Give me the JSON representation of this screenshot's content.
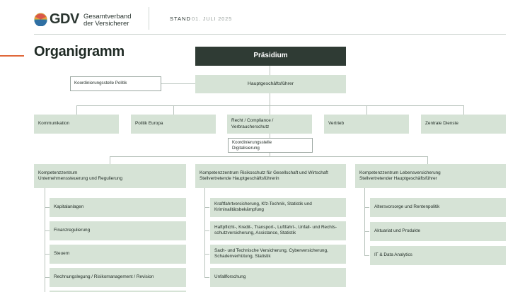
{
  "header": {
    "logo_mark": "GDV",
    "org_line1": "Gesamtverband",
    "org_line2": "der Versicherer",
    "stand_label": "STAND",
    "stand_date": "01. JULI 2025"
  },
  "page_title": "Organigramm",
  "top": {
    "praesidium": "Präsidium",
    "koordinierung_politik": "Koordinierungsstelle Politik",
    "hauptgeschaeftsfuehrer": "Hauptgeschäftsführer"
  },
  "departments": [
    "Kommunikation",
    "Politik Europa",
    "Recht / Compliance / Verbraucherschutz",
    "Vertrieb",
    "Zentrale Dienste"
  ],
  "koordinierung_digital": {
    "line1": "Koordinierungsstelle",
    "line2": "Digitalisierung"
  },
  "centers": [
    {
      "line1": "Kompetenzzentrum",
      "line2": "Unternehmenssteuerung und Regulierung",
      "items": [
        [
          "Kapitalanlagen"
        ],
        [
          "Finanzregulierung"
        ],
        [
          "Steuern"
        ],
        [
          "Rechnungslegung / Risikomanagement / Revision"
        ]
      ]
    },
    {
      "line1": "Kompetenzzentrum Risikoschutz für Gesellschaft und Wirtschaft",
      "line2": "Stellvertretende Hauptgeschäftsführerin",
      "items": [
        [
          "Kraftfahrtversicherung, Kfz-Technik, Statistik und",
          "Kriminalitätsbekämpfung"
        ],
        [
          "Haftpflicht-, Kredit-, Transport-, Luftfahrt-, Unfall- und Rechts-",
          "schutzversicherung, Assistance, Statistik"
        ],
        [
          "Sach- und Technische Versicherung, Cyberversicherung,",
          "Schadenverhütung, Statistik"
        ],
        [
          "Unfallforschung"
        ]
      ]
    },
    {
      "line1": "Kompetenzzentrum Lebensversicherung",
      "line2": "Stellvertretender Hauptgeschäftsführer",
      "items": [
        [
          "Altersvorsorge und Rentenpolitik"
        ],
        [
          "Aktuariat und Produkte"
        ],
        [
          "IT & Data Analytics"
        ]
      ]
    }
  ],
  "colors": {
    "box_fill": "#d6e3d6",
    "praesidium_fill": "#2f3b34",
    "accent_orange": "#e0683a",
    "connector": "#b8c3bc"
  }
}
